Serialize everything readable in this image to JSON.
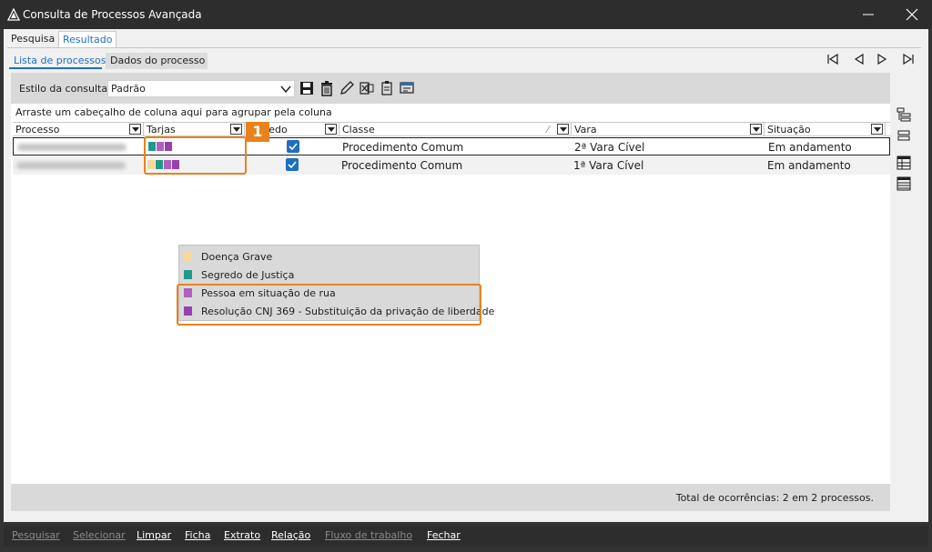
{
  "window": {
    "title": "Consulta de Processos Avançada",
    "minimize_icon": "minimize-icon",
    "close_icon": "close-icon"
  },
  "tabs": [
    {
      "label": "Pesquisa",
      "active": false
    },
    {
      "label": "Resultado",
      "active": true
    }
  ],
  "subtabs": [
    {
      "label": "Lista de processos",
      "active": true
    },
    {
      "label": "Dados do processo",
      "active": false
    }
  ],
  "nav": [
    "first-record-icon",
    "previous-record-icon",
    "next-record-icon",
    "last-record-icon"
  ],
  "toolbar": {
    "style_label": "Estilo da consulta",
    "style_value": "Padrão",
    "tools": [
      "save-icon",
      "delete-icon",
      "edit-icon",
      "export-excel-icon",
      "clipboard-icon",
      "settings-window-icon"
    ]
  },
  "grid": {
    "group_hint": "Arraste um cabeçalho de coluna aqui para agrupar pela coluna",
    "columns": [
      "Processo",
      "Tarjas",
      "redo",
      "Classe",
      "Vara",
      "Situação"
    ],
    "rows": [
      {
        "classe": "Procedimento Comum",
        "vara": "2ª Vara Cível",
        "situacao": "Em andamento",
        "checked": true,
        "tarjas": [
          "#1f9a8a",
          "#b060c0",
          "#9a3fb0"
        ]
      },
      {
        "classe": "Procedimento Comum",
        "vara": "1ª Vara Cível",
        "situacao": "Em andamento",
        "checked": true,
        "tarjas": [
          "#f8d89a",
          "#1f9a8a",
          "#b060c0",
          "#9a3fb0"
        ]
      }
    ],
    "total": "Total de ocorrências: 2 em 2 processos."
  },
  "legend": [
    {
      "label": "Doença Grave",
      "color": "#f8d89a"
    },
    {
      "label": "Segredo de Justiça",
      "color": "#1f9a8a"
    },
    {
      "label": "Pessoa em situação de rua",
      "color": "#b060c0"
    },
    {
      "label": "Resolução CNJ 369 - Substituição da privação de liberdade",
      "color": "#9a3fb0"
    }
  ],
  "callout": "1",
  "highlight_color": "#e8821e",
  "accent_color": "#1f6fbf",
  "side_tools": [
    "tree-view-icon",
    "collapse-icon",
    "table-view-icon",
    "list-view-icon"
  ],
  "bottom_buttons": [
    {
      "label": "Pesquisar",
      "enabled": false
    },
    {
      "label": "Selecionar",
      "enabled": false
    },
    {
      "label": "Limpar",
      "enabled": true
    },
    {
      "label": "Ficha",
      "enabled": true
    },
    {
      "label": "Extrato",
      "enabled": true
    },
    {
      "label": "Relação",
      "enabled": true
    },
    {
      "label": "Fluxo de trabalho",
      "enabled": false
    },
    {
      "label": "Fechar",
      "enabled": true
    }
  ]
}
